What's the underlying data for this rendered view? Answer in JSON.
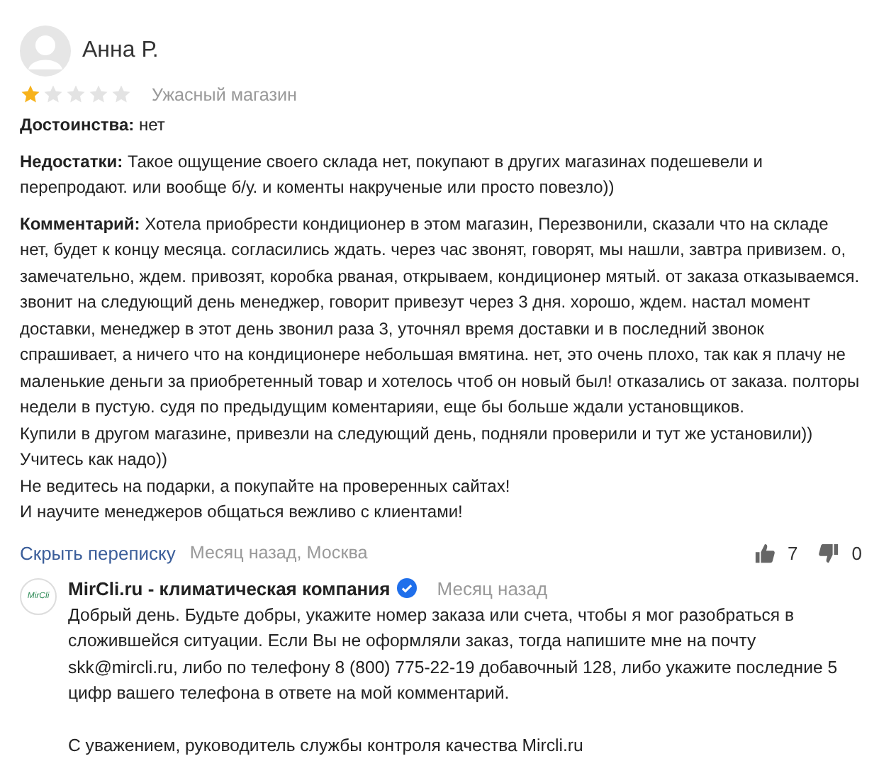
{
  "review": {
    "author": "Анна Р.",
    "stars": 1,
    "title": "Ужасный магазин",
    "pros": "**Достоинства:** нет",
    "cons": "**Недостатки:** Такое ощущение своего склада нет, покупают в других магазинах подешевели и перепродают. или вообще б/у. и коменты накрученые или просто повезло))",
    "comment": [
      "**Комментарий:** Хотела приобрести кондиционер в этом магазин, Перезвонили, сказали что на складе нет, будет к концу месяца. согласились ждать. через час звонят, говорят, мы нашли, завтра привизем. о, замечательно, ждем. привозят, коробка рваная, открываем, кондиционер мятый. от заказа отказываемся. звонит на следующий день менеджер, говорит привезут через 3 дня. хорошо, ждем. настал момент доставки, менеджер в этот день звонил раза 3, уточнял время доставки и в последний звонок спрашивает, а ничего что на кондиционере небольшая вмятина. нет, это очень плохо, так как я плачу не маленькие деньги за приобретенный товар и хотелось чтоб он новый был! отказались от заказа. полторы недели в пустую. судя по предыдущим коментарияи, еще бы больше ждали установщиков.",
      "Купили в другом магазине, привезли на следующий день, подняли проверили и тут же установили))",
      "Учитесь как надо))",
      "Не ведитесь на подарки, а покупайте на проверенных сайтах!",
      "И научите менеджеров общаться вежливо с клиентами!"
    ],
    "hide_link": "Скрыть переписку",
    "meta": "Месяц назад, Москва",
    "likes": "7",
    "dislikes": "0"
  },
  "reply": {
    "logo": "MirCli",
    "author": "MirCli.ru - климатическая компания",
    "verified": true,
    "date": "Месяц назад",
    "paragraphs": [
      "Добрый день. Будьте добры, укажите номер заказа или счета, чтобы я мог разобраться в сложившейся ситуации. Если Вы не оформляли заказ, тогда напишите мне на почту skk@mircli.ru, либо по телефону 8 (800) 775-22-19 добавочный 128, либо укажите последние 5 цифр вашего телефона в ответе на мой комментарий.",
      "С уважением, руководитель службы контроля качества Mircli.ru"
    ]
  }
}
